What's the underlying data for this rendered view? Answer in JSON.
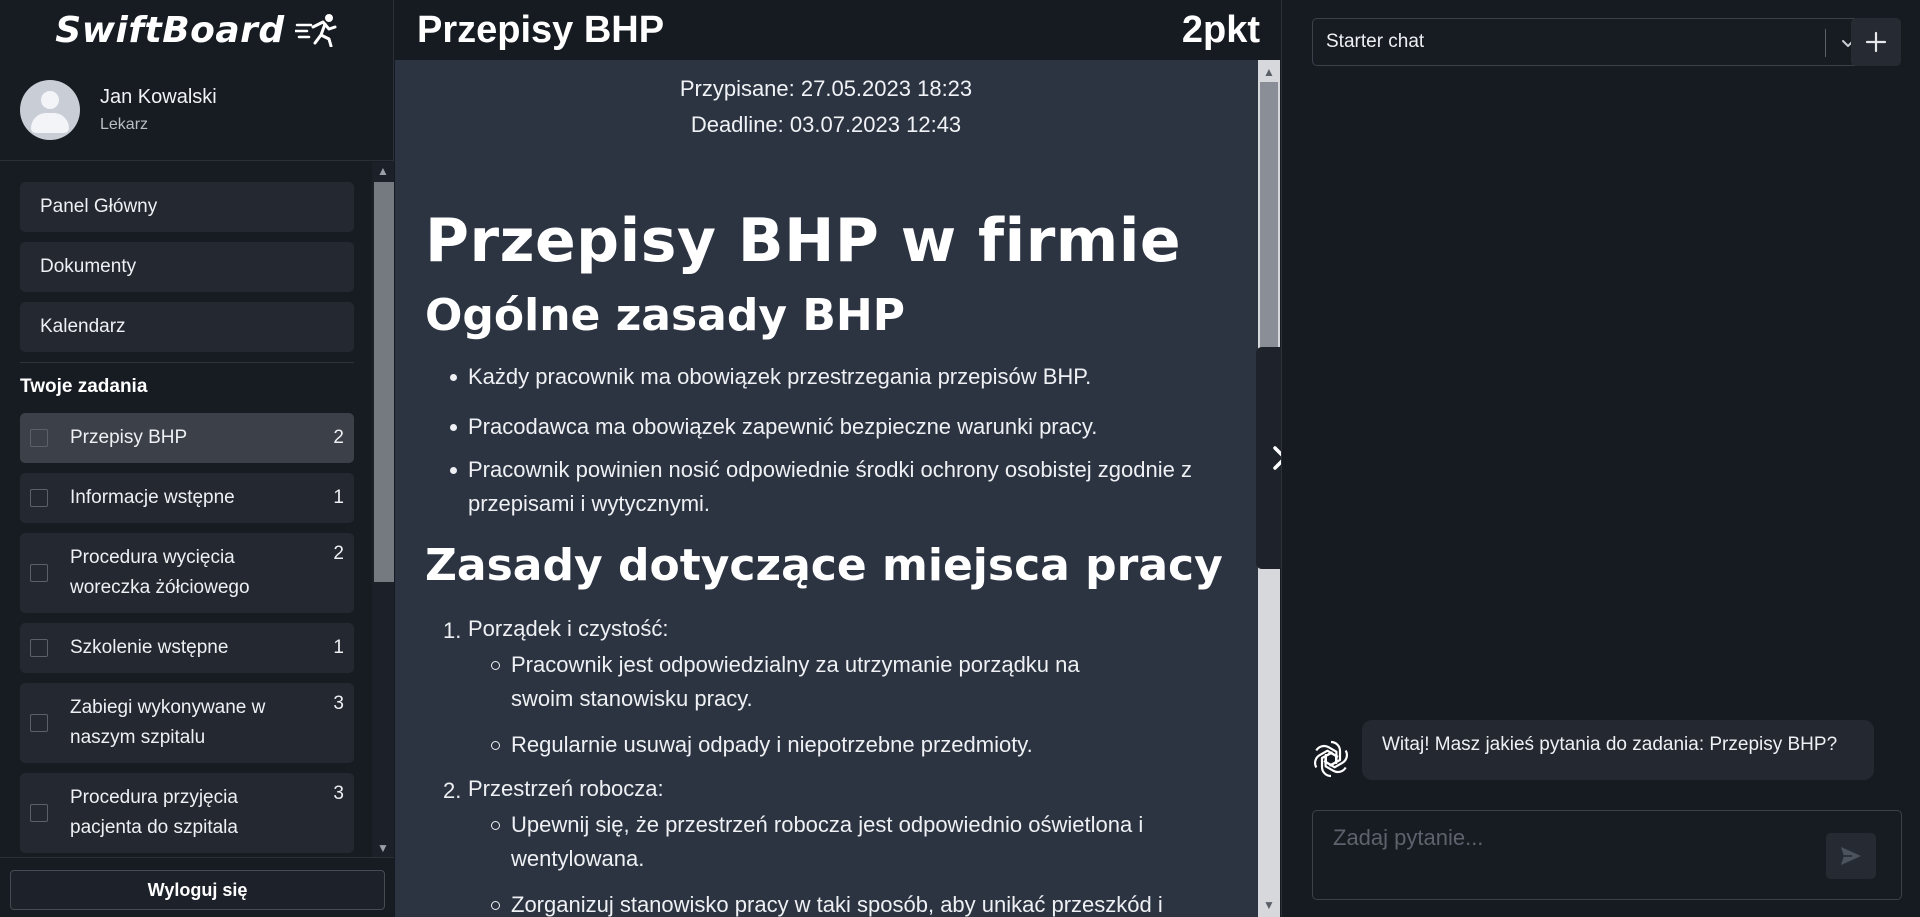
{
  "brand": {
    "name": "SwiftBoard",
    "logo_icon": "running-figure-icon"
  },
  "user": {
    "name": "Jan Kowalski",
    "role": "Lekarz"
  },
  "nav": {
    "items": [
      {
        "label": "Panel Główny"
      },
      {
        "label": "Dokumenty"
      },
      {
        "label": "Kalendarz"
      }
    ]
  },
  "tasks": {
    "title": "Twoje zadania",
    "items": [
      {
        "label": "Przepisy BHP",
        "count": "2",
        "active": true
      },
      {
        "label": "Informacje wstępne",
        "count": "1"
      },
      {
        "label": "Procedura wycięcia woreczka żółciowego",
        "count": "2"
      },
      {
        "label": "Szkolenie wstępne",
        "count": "1"
      },
      {
        "label": "Zabiegi wykonywane w naszym szpitalu",
        "count": "3"
      },
      {
        "label": "Procedura przyjęcia pacjenta do szpitala",
        "count": "3"
      }
    ]
  },
  "logout": {
    "label": "Wyloguj się"
  },
  "main": {
    "title": "Przepisy BHP",
    "points": "2pkt",
    "assigned": "Przypisane: 27.05.2023 18:23",
    "deadline": "Deadline: 03.07.2023 12:43",
    "h1": "Przepisy BHP w firmie",
    "section1": {
      "heading": "Ogólne zasady BHP",
      "bullets": [
        "Każdy pracownik ma obowiązek przestrzegania przepisów BHP.",
        "Pracodawca ma obowiązek zapewnić bezpieczne warunki pracy.",
        "Pracownik powinien nosić odpowiednie środki ochrony osobistej zgodnie z przepisami i wytycznymi."
      ]
    },
    "section2": {
      "heading": "Zasady dotyczące miejsca pracy",
      "items": [
        {
          "number": "1.",
          "label": "Porządek i czystość:",
          "subs": [
            "Pracownik jest odpowiedzialny za utrzymanie porządku na swoim stanowisku pracy.",
            "Regularnie usuwaj odpady i niepotrzebne przedmioty."
          ]
        },
        {
          "number": "2.",
          "label": "Przestrzeń robocza:",
          "subs": [
            "Upewnij się, że przestrzeń robocza jest odpowiednio oświetlona i wentylowana.",
            "Zorganizuj stanowisko pracy w taki sposób, aby unikać przeszkód i"
          ]
        }
      ]
    }
  },
  "chat": {
    "selected_chat": "Starter chat",
    "welcome": "Witaj! Masz jakieś pytania do zadania: Przepisy BHP?",
    "input_placeholder": "Zadaj pytanie...",
    "bot_icon": "openai-logo-icon"
  },
  "colors": {
    "background": "#161a21",
    "panel": "#2c3442",
    "card": "#232831",
    "card_active": "#3b4049"
  }
}
